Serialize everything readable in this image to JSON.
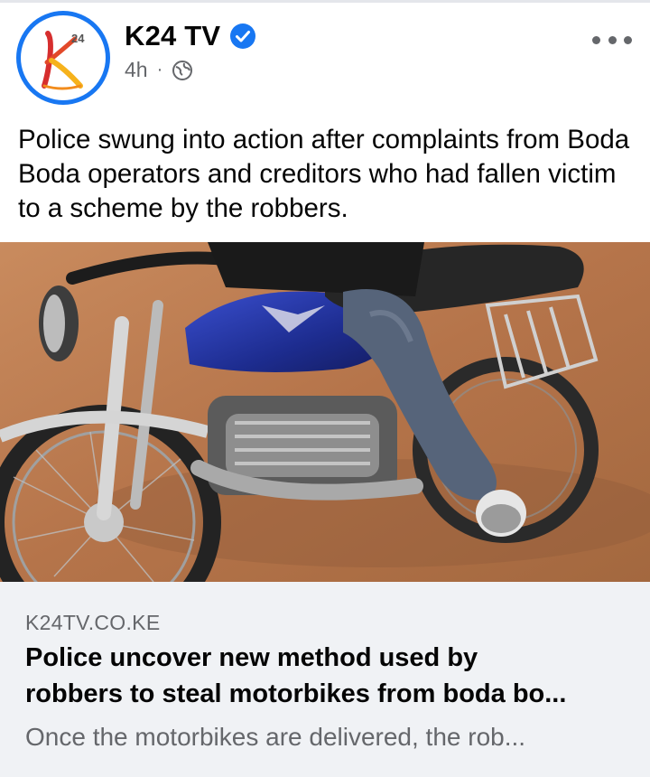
{
  "post": {
    "author": "K24 TV",
    "verified": true,
    "time": "4h",
    "separator": "·",
    "privacy_icon": "globe-icon",
    "more_icon": "more-options-icon",
    "caption": "Police swung into action after complaints from Boda Boda operators and creditors who had fallen victim to a scheme by the robbers."
  },
  "avatar": {
    "logo_letter": "K",
    "logo_sup": "24"
  },
  "link_preview": {
    "domain": "K24TV.CO.KE",
    "title_line1": "Police uncover new method used by",
    "title_line2": "robbers to steal motorbikes from boda bo...",
    "description": "Once the motorbikes are delivered, the rob..."
  },
  "colors": {
    "brand_blue": "#1877f2",
    "logo_orange": "#f28c1c",
    "logo_red": "#d62e2e",
    "secondary_text": "#65676b",
    "card_bg": "#f0f2f5"
  }
}
